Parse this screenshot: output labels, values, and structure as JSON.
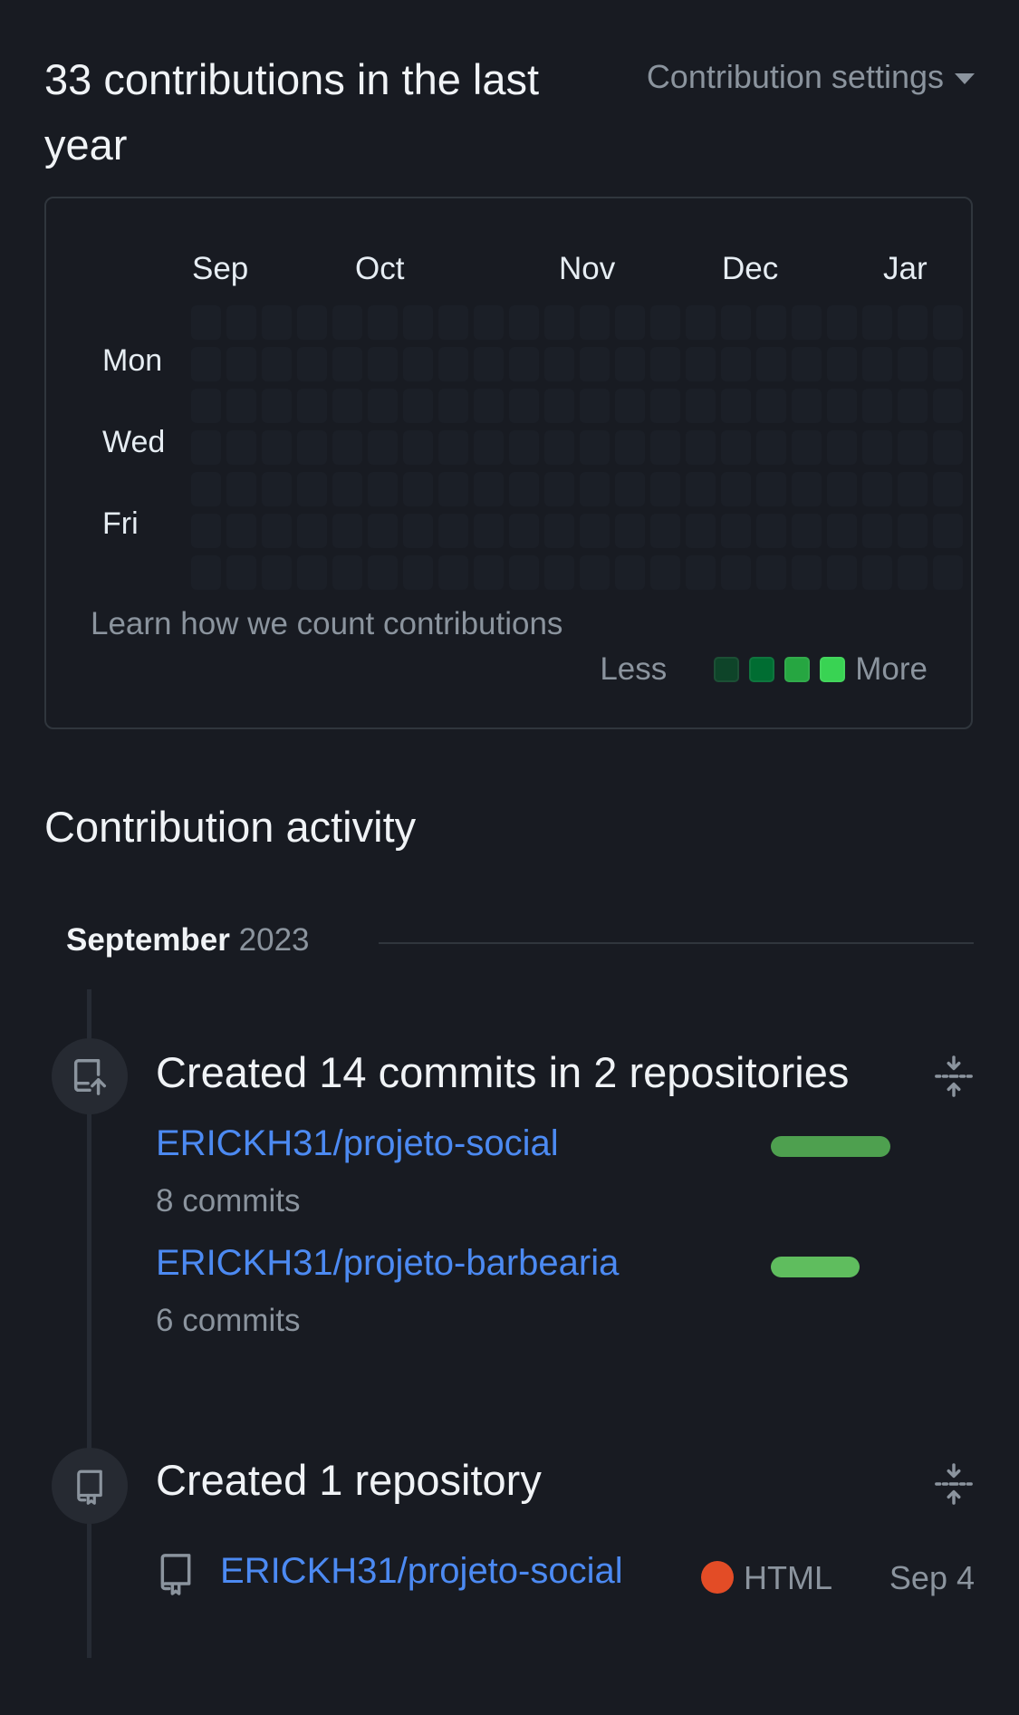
{
  "header": {
    "title": "33 contributions in the last year",
    "settings_label": "Contribution settings",
    "settings_icon": "caret-down-icon"
  },
  "calendar": {
    "months": [
      "Sep",
      "Oct",
      "Nov",
      "Dec",
      "Jar"
    ],
    "days": [
      "Mon",
      "Wed",
      "Fri"
    ],
    "learn_link": "Learn how we count contributions",
    "legend": {
      "less": "Less",
      "more": "More",
      "colors": [
        "#0e4429",
        "#006d32",
        "#26a641",
        "#39d353"
      ]
    }
  },
  "activity": {
    "title": "Contribution activity",
    "month": "September",
    "year": "2023",
    "events": [
      {
        "icon": "repo-push-icon",
        "title": "Created 14 commits in 2 repositories",
        "repos": [
          {
            "name": "ERICKH31/projeto-social",
            "commits": "8 commits",
            "share": 8
          },
          {
            "name": "ERICKH31/projeto-barbearia",
            "commits": "6 commits",
            "share": 6
          }
        ]
      },
      {
        "icon": "repo-icon",
        "title": "Created 1 repository",
        "repo": {
          "name": "ERICKH31/projeto-social",
          "language": "HTML",
          "language_color": "#e34c26",
          "date": "Sep 4"
        }
      }
    ]
  },
  "colors": {
    "background": "#181b22",
    "link": "#4c8af2",
    "bar_1": "#4ea04f",
    "bar_2": "#5fbd5e"
  }
}
